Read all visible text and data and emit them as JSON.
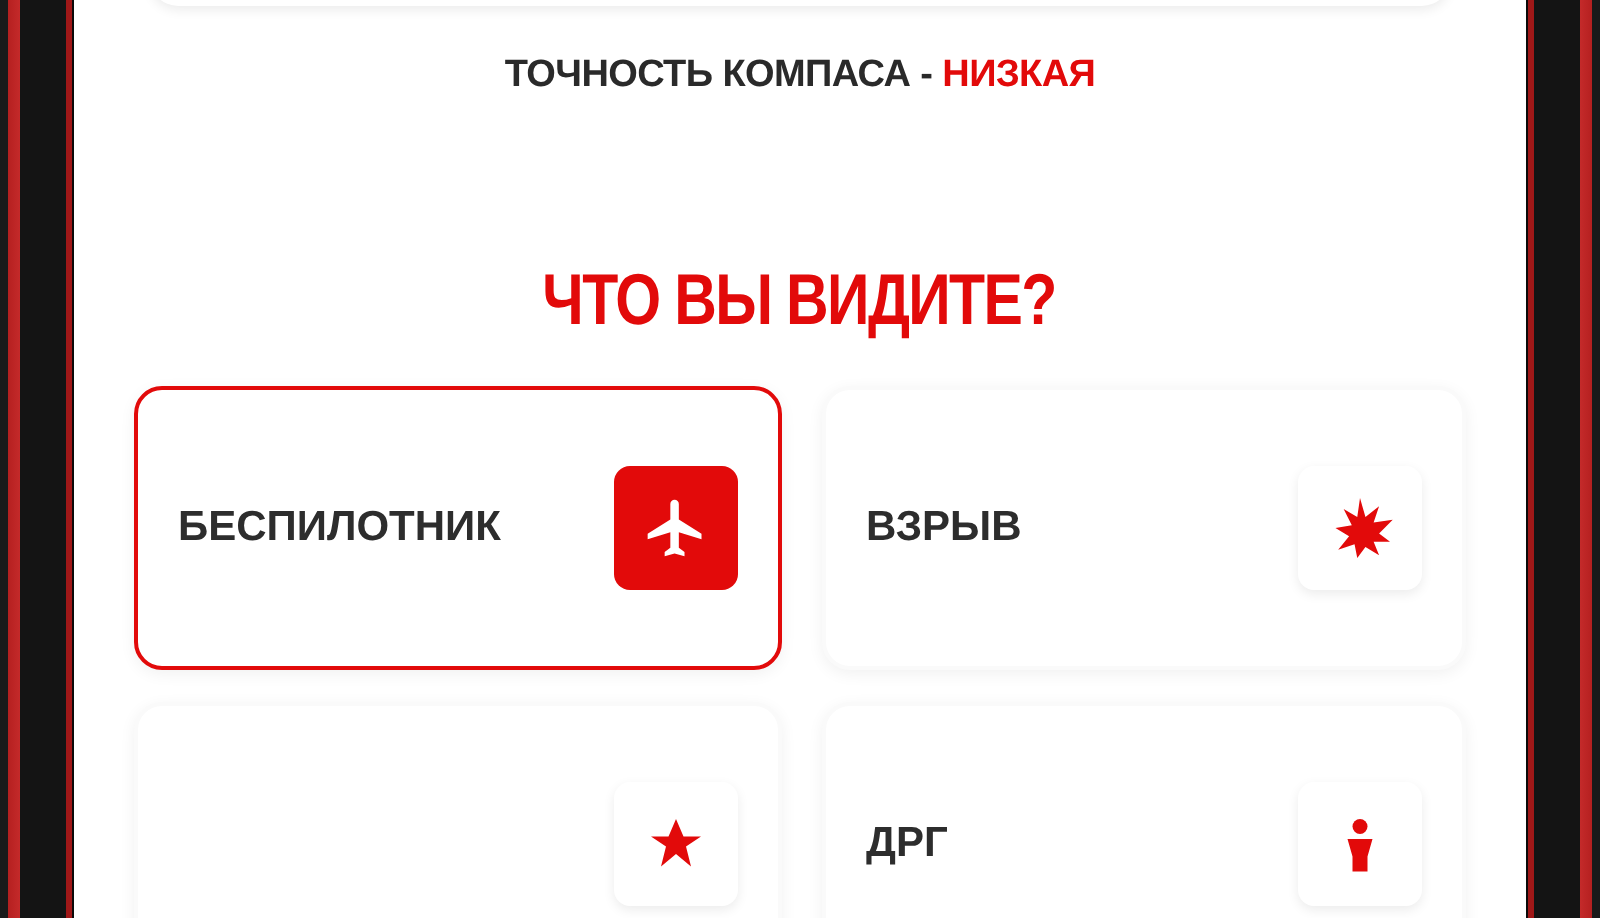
{
  "compass": {
    "label": "ТОЧНОСТЬ КОМПАСА -",
    "value": "НИЗКАЯ"
  },
  "heading": "ЧТО ВЫ ВИДИТЕ?",
  "options": [
    {
      "label": "БЕСПИЛОТНИК",
      "selected": true
    },
    {
      "label": "ВЗРЫВ",
      "selected": false
    },
    {
      "selected": false
    },
    {
      "label": "ДРГ",
      "selected": false
    }
  ]
}
